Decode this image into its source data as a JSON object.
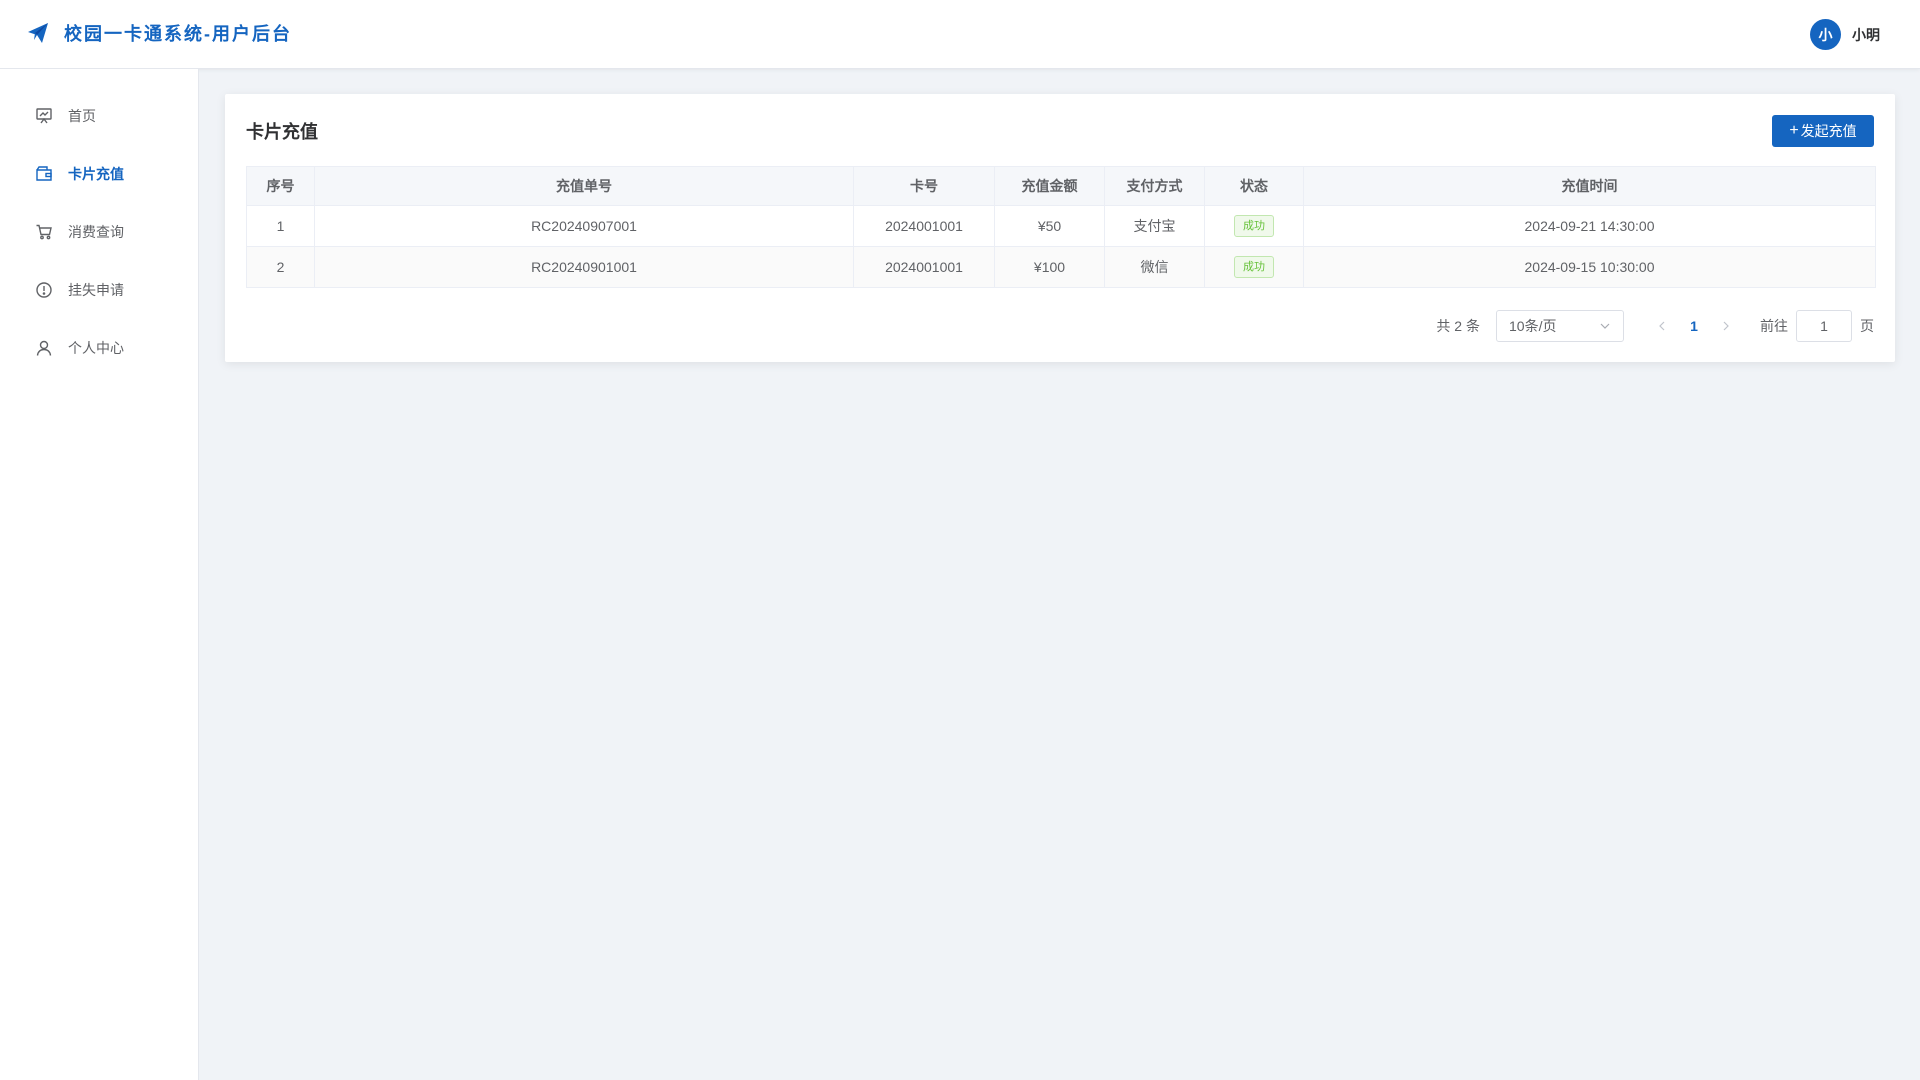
{
  "app": {
    "title": "校园一卡通系统-用户后台",
    "brand_icon": "paper-plane-icon",
    "brand_color": "#1565c0"
  },
  "user": {
    "avatar_text": "小",
    "name": "小明"
  },
  "sidebar": {
    "items": [
      {
        "label": "首页",
        "icon": "presentation-chart-icon",
        "active": false
      },
      {
        "label": "卡片充值",
        "icon": "wallet-icon",
        "active": true
      },
      {
        "label": "消费查询",
        "icon": "cart-icon",
        "active": false
      },
      {
        "label": "挂失申请",
        "icon": "alert-circle-icon",
        "active": false
      },
      {
        "label": "个人中心",
        "icon": "user-icon",
        "active": false
      }
    ]
  },
  "main": {
    "title": "卡片充值",
    "add_button": {
      "plus": "+",
      "label": "发起充值"
    },
    "table": {
      "headers": [
        "序号",
        "充值单号",
        "卡号",
        "充值金额",
        "支付方式",
        "状态",
        "充值时间"
      ],
      "rows": [
        [
          "1",
          "RC20240907001",
          "2024001001",
          "¥50",
          "支付宝",
          "成功",
          "2024-09-21 14:30:00"
        ],
        [
          "2",
          "RC20240901001",
          "2024001001",
          "¥100",
          "微信",
          "成功",
          "2024-09-15 10:30:00"
        ]
      ]
    },
    "pagination": {
      "total_text": "共 2 条",
      "page_size": "10条/页",
      "current_page": "1",
      "goto_label": "前往",
      "goto_value": "1",
      "goto_suffix": "页"
    }
  },
  "colors": {
    "accent": "#1565c0",
    "success": "#67c23a"
  }
}
